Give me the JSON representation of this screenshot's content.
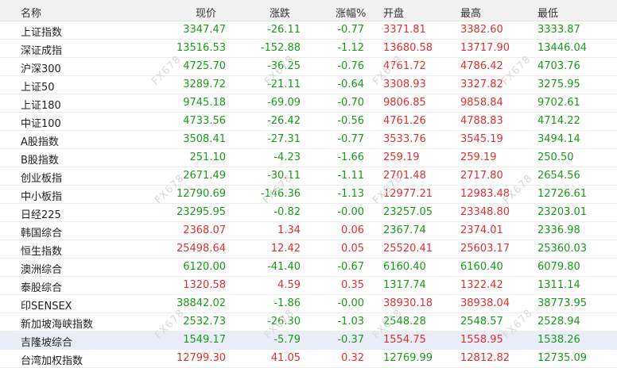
{
  "columns": [
    "名称",
    "现价",
    "涨跌",
    "涨幅%",
    "开盘",
    "最高",
    "最低"
  ],
  "colors": {
    "up": "#e03030",
    "down": "#1a9a1a"
  },
  "rows": [
    {
      "name": "上证指数",
      "price": "3347.47",
      "change": "-26.11",
      "pct": "-0.77",
      "open": "3371.81",
      "high": "3382.60",
      "low": "3333.87",
      "dir": [
        "down",
        "down",
        "down",
        "up",
        "up",
        "down"
      ]
    },
    {
      "name": "深证成指",
      "price": "13516.53",
      "change": "-152.88",
      "pct": "-1.12",
      "open": "13680.58",
      "high": "13717.90",
      "low": "13446.04",
      "dir": [
        "down",
        "down",
        "down",
        "up",
        "up",
        "down"
      ]
    },
    {
      "name": "沪深300",
      "price": "4725.70",
      "change": "-36.25",
      "pct": "-0.76",
      "open": "4761.72",
      "high": "4786.42",
      "low": "4703.76",
      "dir": [
        "down",
        "down",
        "down",
        "up",
        "up",
        "down"
      ]
    },
    {
      "name": "上证50",
      "price": "3289.72",
      "change": "-21.11",
      "pct": "-0.64",
      "open": "3308.93",
      "high": "3327.82",
      "low": "3275.95",
      "dir": [
        "down",
        "down",
        "down",
        "up",
        "up",
        "down"
      ]
    },
    {
      "name": "上证180",
      "price": "9745.18",
      "change": "-69.09",
      "pct": "-0.70",
      "open": "9806.85",
      "high": "9858.84",
      "low": "9702.61",
      "dir": [
        "down",
        "down",
        "down",
        "up",
        "up",
        "down"
      ]
    },
    {
      "name": "中证100",
      "price": "4733.56",
      "change": "-26.42",
      "pct": "-0.56",
      "open": "4761.26",
      "high": "4788.83",
      "low": "4714.22",
      "dir": [
        "down",
        "down",
        "down",
        "up",
        "up",
        "down"
      ]
    },
    {
      "name": "A股指数",
      "price": "3508.41",
      "change": "-27.31",
      "pct": "-0.77",
      "open": "3533.76",
      "high": "3545.19",
      "low": "3494.14",
      "dir": [
        "down",
        "down",
        "down",
        "up",
        "up",
        "down"
      ]
    },
    {
      "name": "B股指数",
      "price": "251.10",
      "change": "-4.23",
      "pct": "-1.66",
      "open": "259.19",
      "high": "259.19",
      "low": "250.50",
      "dir": [
        "down",
        "down",
        "down",
        "up",
        "up",
        "down"
      ]
    },
    {
      "name": "创业板指",
      "price": "2671.49",
      "change": "-30.11",
      "pct": "-1.11",
      "open": "2701.48",
      "high": "2717.80",
      "low": "2654.56",
      "dir": [
        "down",
        "down",
        "down",
        "up",
        "up",
        "down"
      ]
    },
    {
      "name": "中小板指",
      "price": "12790.69",
      "change": "-146.36",
      "pct": "-1.13",
      "open": "12977.21",
      "high": "12983.48",
      "low": "12726.61",
      "dir": [
        "down",
        "down",
        "down",
        "up",
        "up",
        "down"
      ]
    },
    {
      "name": "日经225",
      "price": "23295.95",
      "change": "-0.82",
      "pct": "-0.00",
      "open": "23257.05",
      "high": "23348.80",
      "low": "23203.01",
      "dir": [
        "down",
        "down",
        "down",
        "down",
        "up",
        "down"
      ]
    },
    {
      "name": "韩国综合",
      "price": "2368.07",
      "change": "1.34",
      "pct": "0.06",
      "open": "2367.74",
      "high": "2374.01",
      "low": "2336.98",
      "dir": [
        "up",
        "up",
        "up",
        "down",
        "up",
        "down"
      ]
    },
    {
      "name": "恒生指数",
      "price": "25498.64",
      "change": "12.42",
      "pct": "0.05",
      "open": "25520.41",
      "high": "25603.17",
      "low": "25360.03",
      "dir": [
        "up",
        "up",
        "up",
        "up",
        "up",
        "down"
      ]
    },
    {
      "name": "澳洲综合",
      "price": "6120.00",
      "change": "-41.40",
      "pct": "-0.67",
      "open": "6160.40",
      "high": "6160.40",
      "low": "6079.80",
      "dir": [
        "down",
        "down",
        "down",
        "down",
        "down",
        "down"
      ]
    },
    {
      "name": "泰股综合",
      "price": "1320.58",
      "change": "4.59",
      "pct": "0.35",
      "open": "1317.74",
      "high": "1322.42",
      "low": "1311.14",
      "dir": [
        "up",
        "up",
        "up",
        "down",
        "up",
        "down"
      ]
    },
    {
      "name": "印SENSEX",
      "price": "38842.02",
      "change": "-1.86",
      "pct": "-0.00",
      "open": "38930.18",
      "high": "38938.04",
      "low": "38773.95",
      "dir": [
        "down",
        "down",
        "down",
        "up",
        "up",
        "down"
      ]
    },
    {
      "name": "新加坡海峡指数",
      "price": "2532.73",
      "change": "-26.30",
      "pct": "-1.03",
      "open": "2548.28",
      "high": "2548.57",
      "low": "2528.94",
      "dir": [
        "down",
        "down",
        "down",
        "down",
        "down",
        "down"
      ]
    },
    {
      "name": "吉隆坡综合",
      "price": "1549.17",
      "change": "-5.79",
      "pct": "-0.37",
      "open": "1554.75",
      "high": "1558.95",
      "low": "1538.26",
      "dir": [
        "down",
        "down",
        "down",
        "up",
        "up",
        "down"
      ]
    },
    {
      "name": "台湾加权指数",
      "price": "12799.30",
      "change": "41.05",
      "pct": "0.32",
      "open": "12769.99",
      "high": "12812.82",
      "low": "12735.09",
      "dir": [
        "up",
        "up",
        "up",
        "down",
        "up",
        "down"
      ]
    }
  ],
  "selected_row": 17,
  "watermark": "FX678"
}
